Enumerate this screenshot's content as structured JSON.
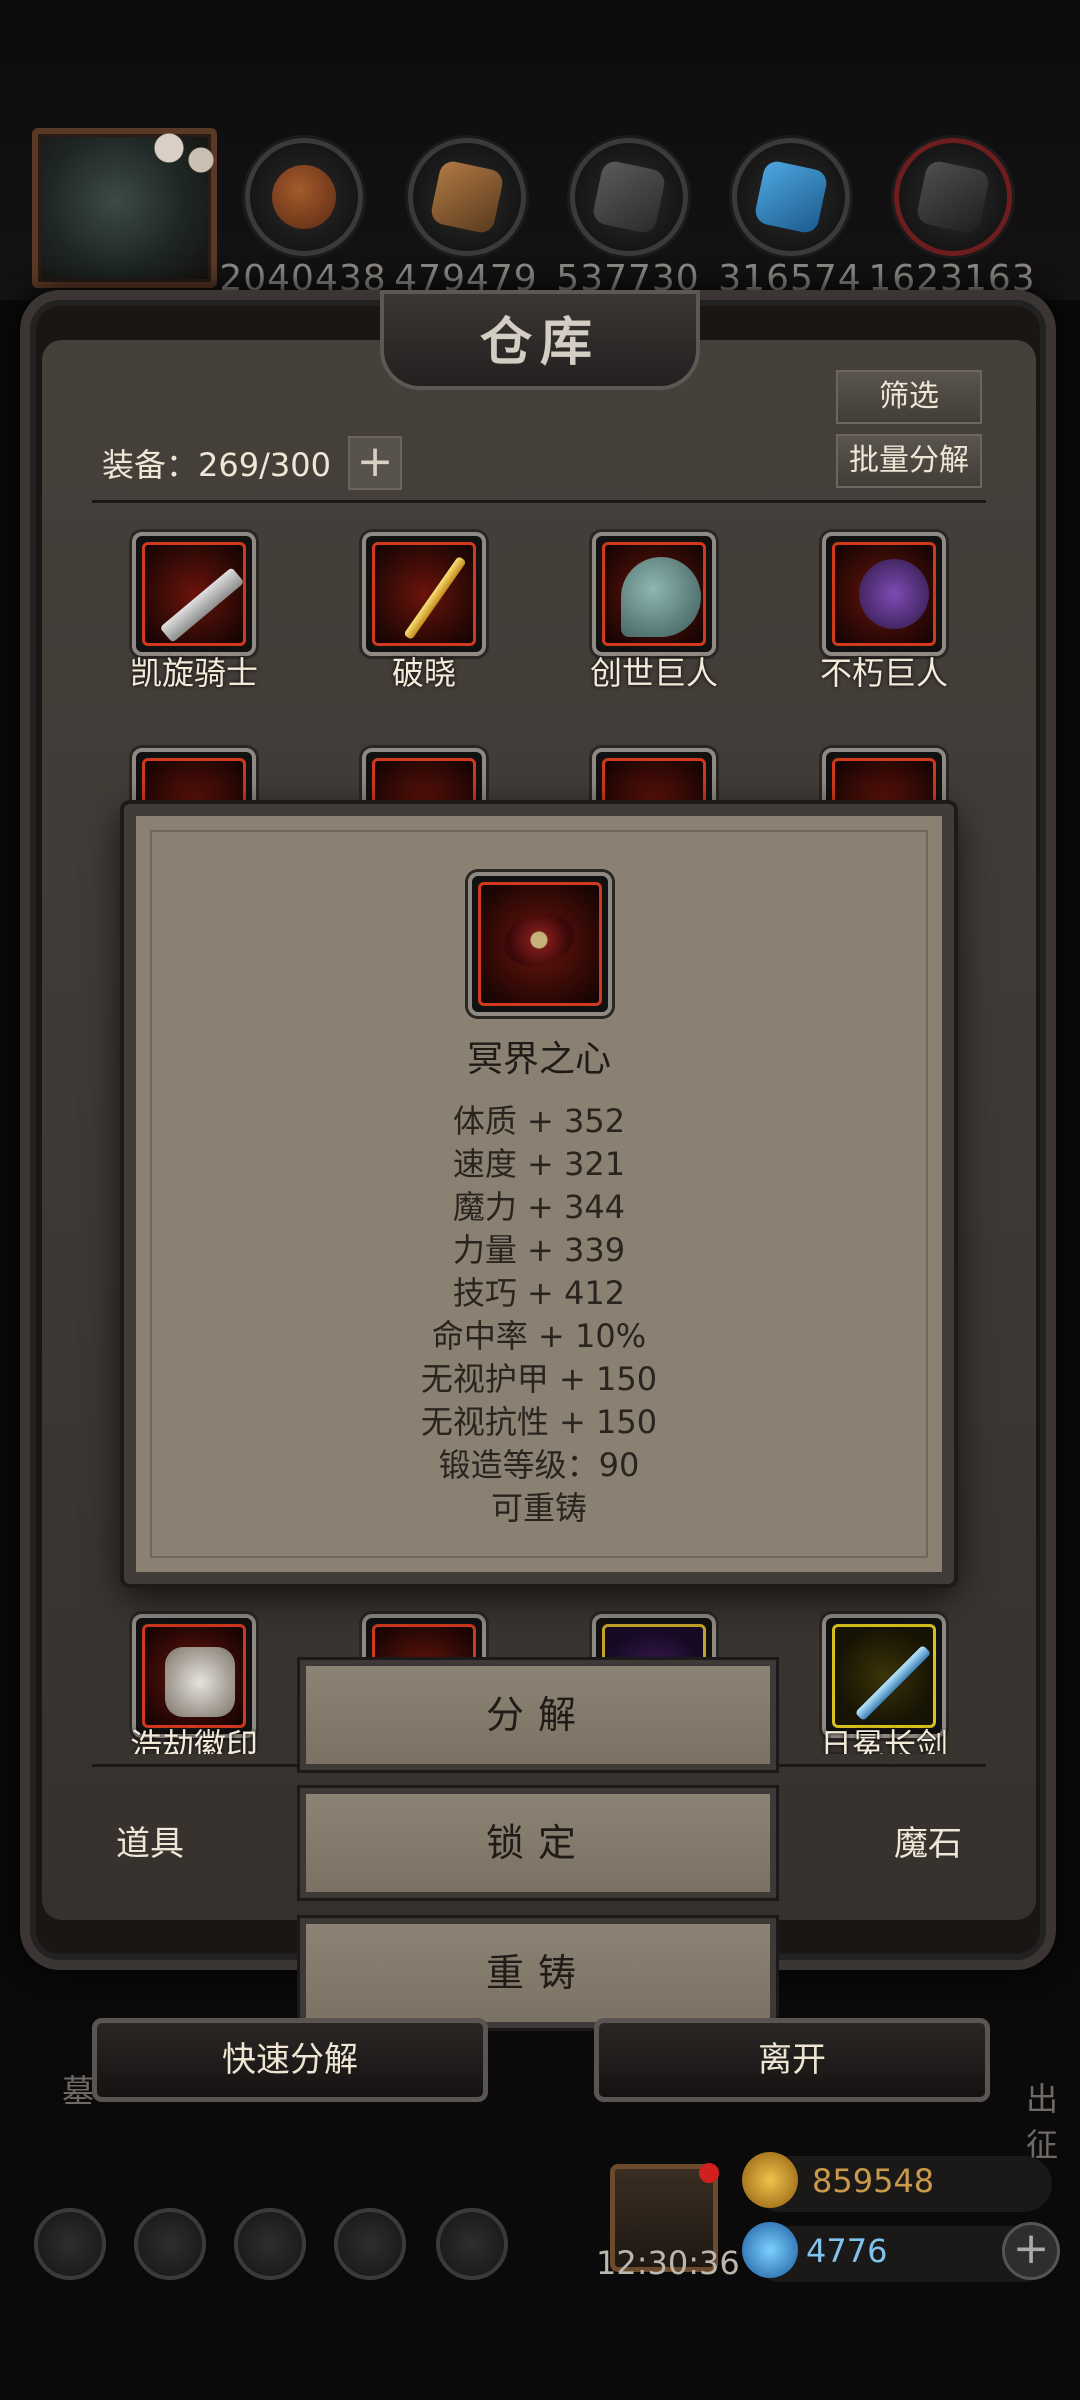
{
  "resources": [
    "2040438",
    "479479",
    "537730",
    "316574",
    "1623163"
  ],
  "warehouse": {
    "title": "仓库",
    "filter_label": "筛选",
    "batch_label": "批量分解",
    "capacity_label": "装备：269/300",
    "plus_label": "+"
  },
  "items": {
    "row1": [
      "凯旋骑士",
      "破晓",
      "创世巨人",
      "不朽巨人"
    ],
    "last_row_left": "浩劫徽印",
    "last_row_right": "日冕长剑"
  },
  "tabs": {
    "left": "道具",
    "right": "魔石"
  },
  "detail": {
    "name": "冥界之心",
    "stats": [
      "体质 + 352",
      "速度 + 321",
      "魔力 + 344",
      "力量 + 339",
      "技巧 + 412",
      "命中率 + 10%",
      "无视护甲 + 150",
      "无视抗性 + 150",
      "锻造等级：90",
      "可重铸"
    ]
  },
  "actions": {
    "decompose": "分解",
    "lock": "锁定",
    "recast": "重铸"
  },
  "bottom": {
    "quick_decompose": "快速分解",
    "leave": "离开",
    "left_peek": "墓",
    "right_peek": "出征",
    "clock": "12:30:36",
    "gold": "859548",
    "gems": "4776",
    "add_label": "+"
  },
  "colors": {
    "gold_text": "#c99a4a",
    "gem_text": "#7fc4ef",
    "rare_border": "#d0391c"
  }
}
